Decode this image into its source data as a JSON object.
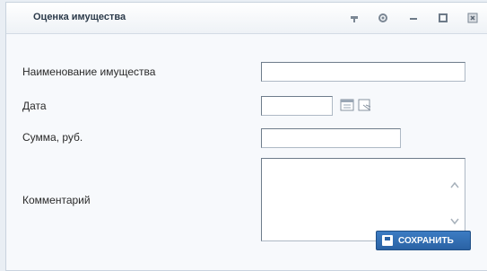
{
  "window": {
    "title": "Оценка имущества",
    "controls": [
      "pin-icon",
      "settings-icon",
      "minimize-icon",
      "maximize-icon",
      "close-icon"
    ]
  },
  "form": {
    "property_name_label": "Наименование имущества",
    "property_name_value": "",
    "date_label": "Дата",
    "date_value": "",
    "sum_label": "Сумма, руб.",
    "sum_value": "",
    "comment_label": "Комментарий",
    "comment_value": ""
  },
  "actions": {
    "save_label": "СОХРАНИТЬ"
  }
}
